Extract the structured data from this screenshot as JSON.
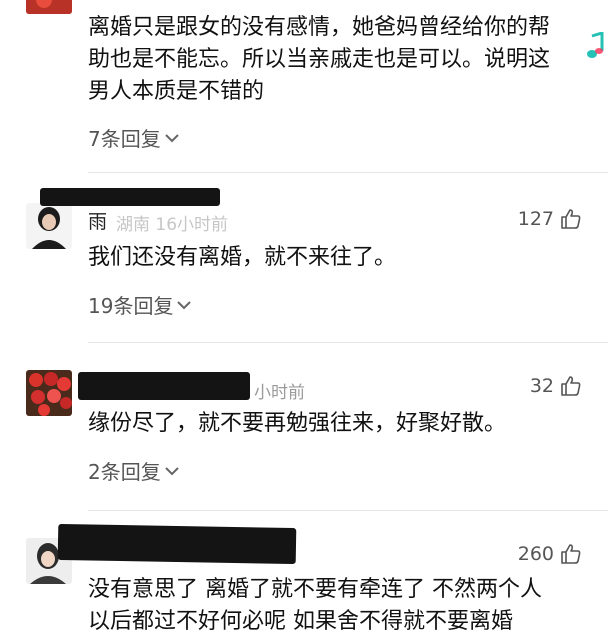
{
  "colors": {
    "accent_note": "#25c1b5",
    "redaction": "#141414"
  },
  "comments": [
    {
      "text_lines": [
        "离婚只是跟女的没有感情，她爸妈曾经给你的帮",
        "助也是不能忘。所以当亲戚走也是可以。说明这",
        "男人本质是不错的"
      ],
      "replies": "7条回复"
    },
    {
      "name": "雨",
      "meta": "湖南 16小时前",
      "likes": "127",
      "text_lines": [
        "我们还没有离婚，就不来往了。"
      ],
      "replies": "19条回复"
    },
    {
      "meta": "小时前",
      "likes": "32",
      "text_lines": [
        "缘份尽了，就不要再勉强往来，好聚好散。"
      ],
      "replies": "2条回复"
    },
    {
      "likes": "260",
      "text_lines": [
        "没有意思了 离婚了就不要有牵连了 不然两个人",
        "以后都过不好何必呢 如果舍不得就不要离婚"
      ]
    }
  ],
  "icons": {
    "like": "thumbs-up-icon",
    "expand": "chevron-down-icon",
    "note": "music-note-icon"
  }
}
